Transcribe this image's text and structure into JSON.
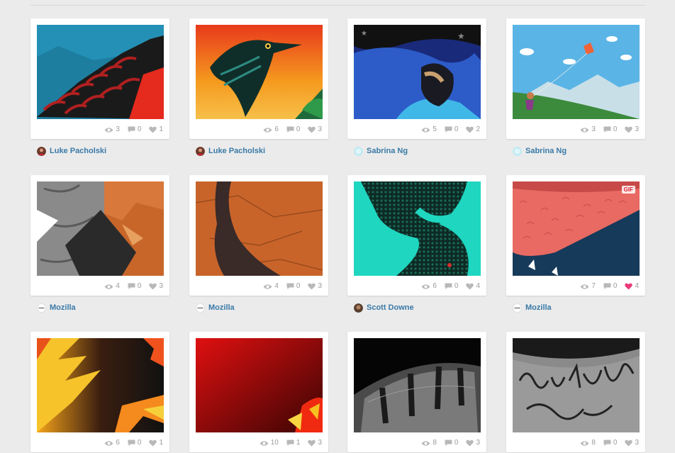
{
  "shots": [
    {
      "author": "Luke Pacholski",
      "avatar": "luke-avatar",
      "views": "3",
      "comments": "0",
      "likes": "1",
      "liked": false
    },
    {
      "author": "Luke Pacholski",
      "avatar": "luke-avatar",
      "views": "6",
      "comments": "0",
      "likes": "3",
      "liked": false
    },
    {
      "author": "Sabrina Ng",
      "avatar": "sabrina-avatar",
      "views": "5",
      "comments": "0",
      "likes": "2",
      "liked": false
    },
    {
      "author": "Sabrina Ng",
      "avatar": "sabrina-avatar",
      "views": "3",
      "comments": "0",
      "likes": "3",
      "liked": false
    },
    {
      "author": "Mozilla",
      "avatar": "mozilla-avatar",
      "views": "4",
      "comments": "0",
      "likes": "3",
      "liked": false
    },
    {
      "author": "Mozilla",
      "avatar": "mozilla-avatar",
      "views": "4",
      "comments": "0",
      "likes": "3",
      "liked": false
    },
    {
      "author": "Scott Downe",
      "avatar": "scott-avatar",
      "views": "6",
      "comments": "0",
      "likes": "4",
      "liked": false
    },
    {
      "author": "Mozilla",
      "avatar": "mozilla-avatar",
      "views": "7",
      "comments": "0",
      "likes": "4",
      "liked": true,
      "badge": "GIF"
    },
    {
      "author": "",
      "avatar": "",
      "views": "6",
      "comments": "0",
      "likes": "1",
      "liked": false
    },
    {
      "author": "",
      "avatar": "",
      "views": "10",
      "comments": "1",
      "likes": "3",
      "liked": false
    },
    {
      "author": "",
      "avatar": "",
      "views": "8",
      "comments": "0",
      "likes": "3",
      "liked": false
    },
    {
      "author": "",
      "avatar": "",
      "views": "8",
      "comments": "0",
      "likes": "3",
      "liked": false
    }
  ],
  "colors": {
    "link": "#3a7aa8",
    "meta": "#9a9a9a",
    "liked": "#ee3a7a",
    "background": "#ebebeb"
  },
  "icons": {
    "views": "eye-icon",
    "comments": "speech-bubble-icon",
    "likes": "heart-icon"
  }
}
